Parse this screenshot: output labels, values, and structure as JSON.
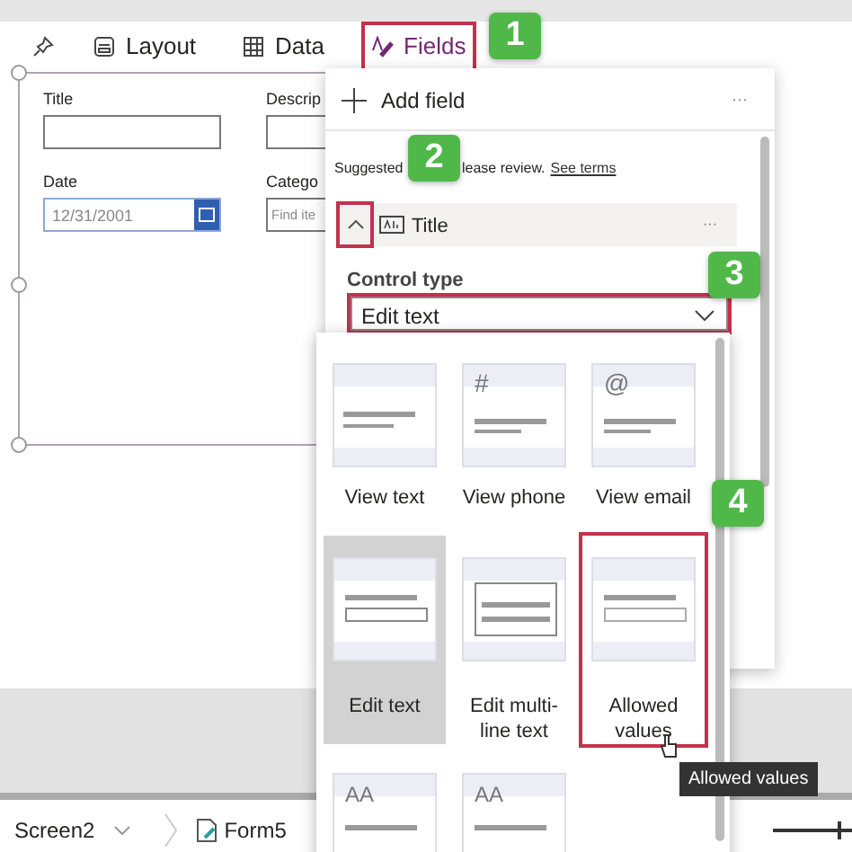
{
  "toolbar": {
    "tabs": [
      {
        "label": "Layout",
        "selected": false,
        "highlighted": false
      },
      {
        "label": "Data",
        "selected": false,
        "highlighted": false
      },
      {
        "label": "Fields",
        "selected": true,
        "highlighted": true
      }
    ]
  },
  "form": {
    "fields": [
      {
        "label": "Title",
        "kind": "text"
      },
      {
        "label": "Descrip",
        "kind": "text"
      },
      {
        "label": "Date",
        "kind": "date",
        "value": "12/31/2001"
      },
      {
        "label": "Catego",
        "kind": "combo",
        "placeholder": "Find ite"
      }
    ]
  },
  "fields_panel": {
    "add_field": "Add field",
    "more": "···",
    "notice_start": "Suggested",
    "notice_end": "lease review.",
    "notice_link": "See terms",
    "field": {
      "name": "Title",
      "expanded": true,
      "highlighted": true,
      "more": "···"
    },
    "control_type": {
      "label": "Control type",
      "value": "Edit text",
      "highlighted": true
    }
  },
  "control_options": [
    {
      "label": "View text",
      "kind": "text",
      "selected": false,
      "highlighted": false
    },
    {
      "label": "View phone",
      "kind": "glyph",
      "glyph": "#",
      "selected": false,
      "highlighted": false
    },
    {
      "label": "View email",
      "kind": "glyph",
      "glyph": "@",
      "selected": false,
      "highlighted": false
    },
    {
      "label": "Edit text",
      "kind": "input",
      "selected": true,
      "highlighted": false
    },
    {
      "label": "Edit multi-line text",
      "kind": "multiline",
      "selected": false,
      "highlighted": false
    },
    {
      "label": "Allowed values",
      "kind": "dropdown",
      "selected": false,
      "highlighted": true
    },
    {
      "kind": "rating",
      "glyph": "AA",
      "selected": false,
      "highlighted": false
    },
    {
      "kind": "rating-input",
      "glyph": "AA",
      "selected": false,
      "highlighted": false
    }
  ],
  "callouts": [
    "1",
    "2",
    "3",
    "4"
  ],
  "tooltip": "Allowed values",
  "status_bar": {
    "screen": "Screen2",
    "form": "Form5",
    "zoom": {
      "level": 0.82
    }
  }
}
